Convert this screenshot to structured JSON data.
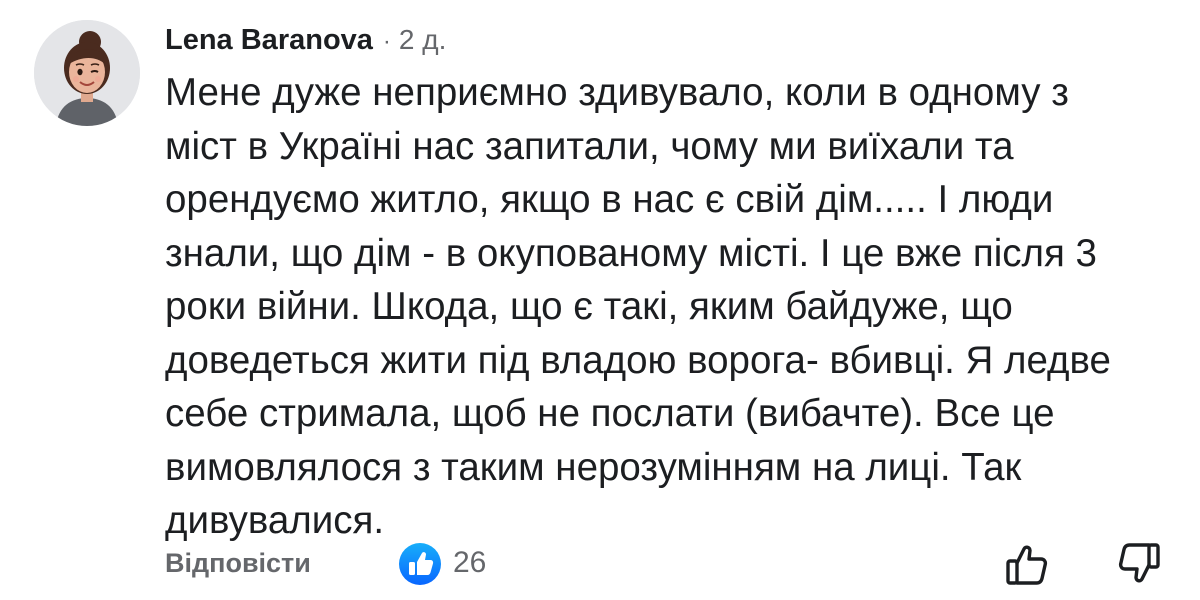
{
  "comment": {
    "author": "Lena Baranova",
    "separator": "·",
    "time": "2 д.",
    "text_lines": [
      "Мене дуже неприємно здивувало, коли в одному з",
      "міст в Україні нас запитали, чому ми виїхали та",
      "орендуємо житло, якщо в нас є свій дім..... І люди",
      "знали, що дім - в окупованому місті. І це вже після 3",
      "роки війни. Шкода, що є такі, яким байдуже, що",
      "доведеться жити під владою ворога- вбивці. Я ледве",
      "себе стримала, щоб не послати (вибачте). Все це",
      "вимовлялося з таким нерозумінням на лиці. Так",
      "дивувалися."
    ]
  },
  "footer": {
    "reply_label": "Відповісти",
    "like_count": "26",
    "like_icon": "like-reaction-icon",
    "upvote_icon": "thumbs-up-icon",
    "downvote_icon": "thumbs-down-icon"
  },
  "colors": {
    "text": "#1c1e21",
    "secondary": "#65676b",
    "like_blue": "#1877f2",
    "avatar_bg": "#e4e5e8"
  }
}
